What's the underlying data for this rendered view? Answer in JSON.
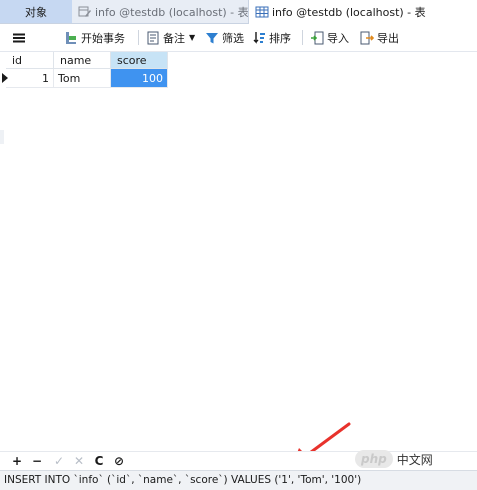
{
  "tabs": [
    {
      "label": "对象"
    },
    {
      "label": "info @testdb (localhost) - 表"
    },
    {
      "label": "info @testdb (localhost) - 表"
    }
  ],
  "toolbar": {
    "begin_transaction": "开始事务",
    "memo": "备注",
    "filter": "筛选",
    "sort": "排序",
    "import": "导入",
    "export": "导出"
  },
  "grid": {
    "columns": [
      "id",
      "name",
      "score"
    ],
    "rows": [
      {
        "id": "1",
        "name": "Tom",
        "score": "100"
      }
    ]
  },
  "bottom_toolbar": {
    "add": "+",
    "delete": "−",
    "apply": "✓",
    "discard": "✕",
    "refresh": "C",
    "stop": "⊘"
  },
  "status": {
    "sql": "INSERT INTO `info` (`id`, `name`, `score`) VALUES ('1', 'Tom', '100')"
  },
  "watermark": {
    "badge": "php",
    "text": "中文网"
  },
  "colors": {
    "active_tab": "#c6d8f2",
    "selected_cell": "#3f93f0",
    "selected_header": "#c7e3f6",
    "arrow": "#e8322c"
  }
}
